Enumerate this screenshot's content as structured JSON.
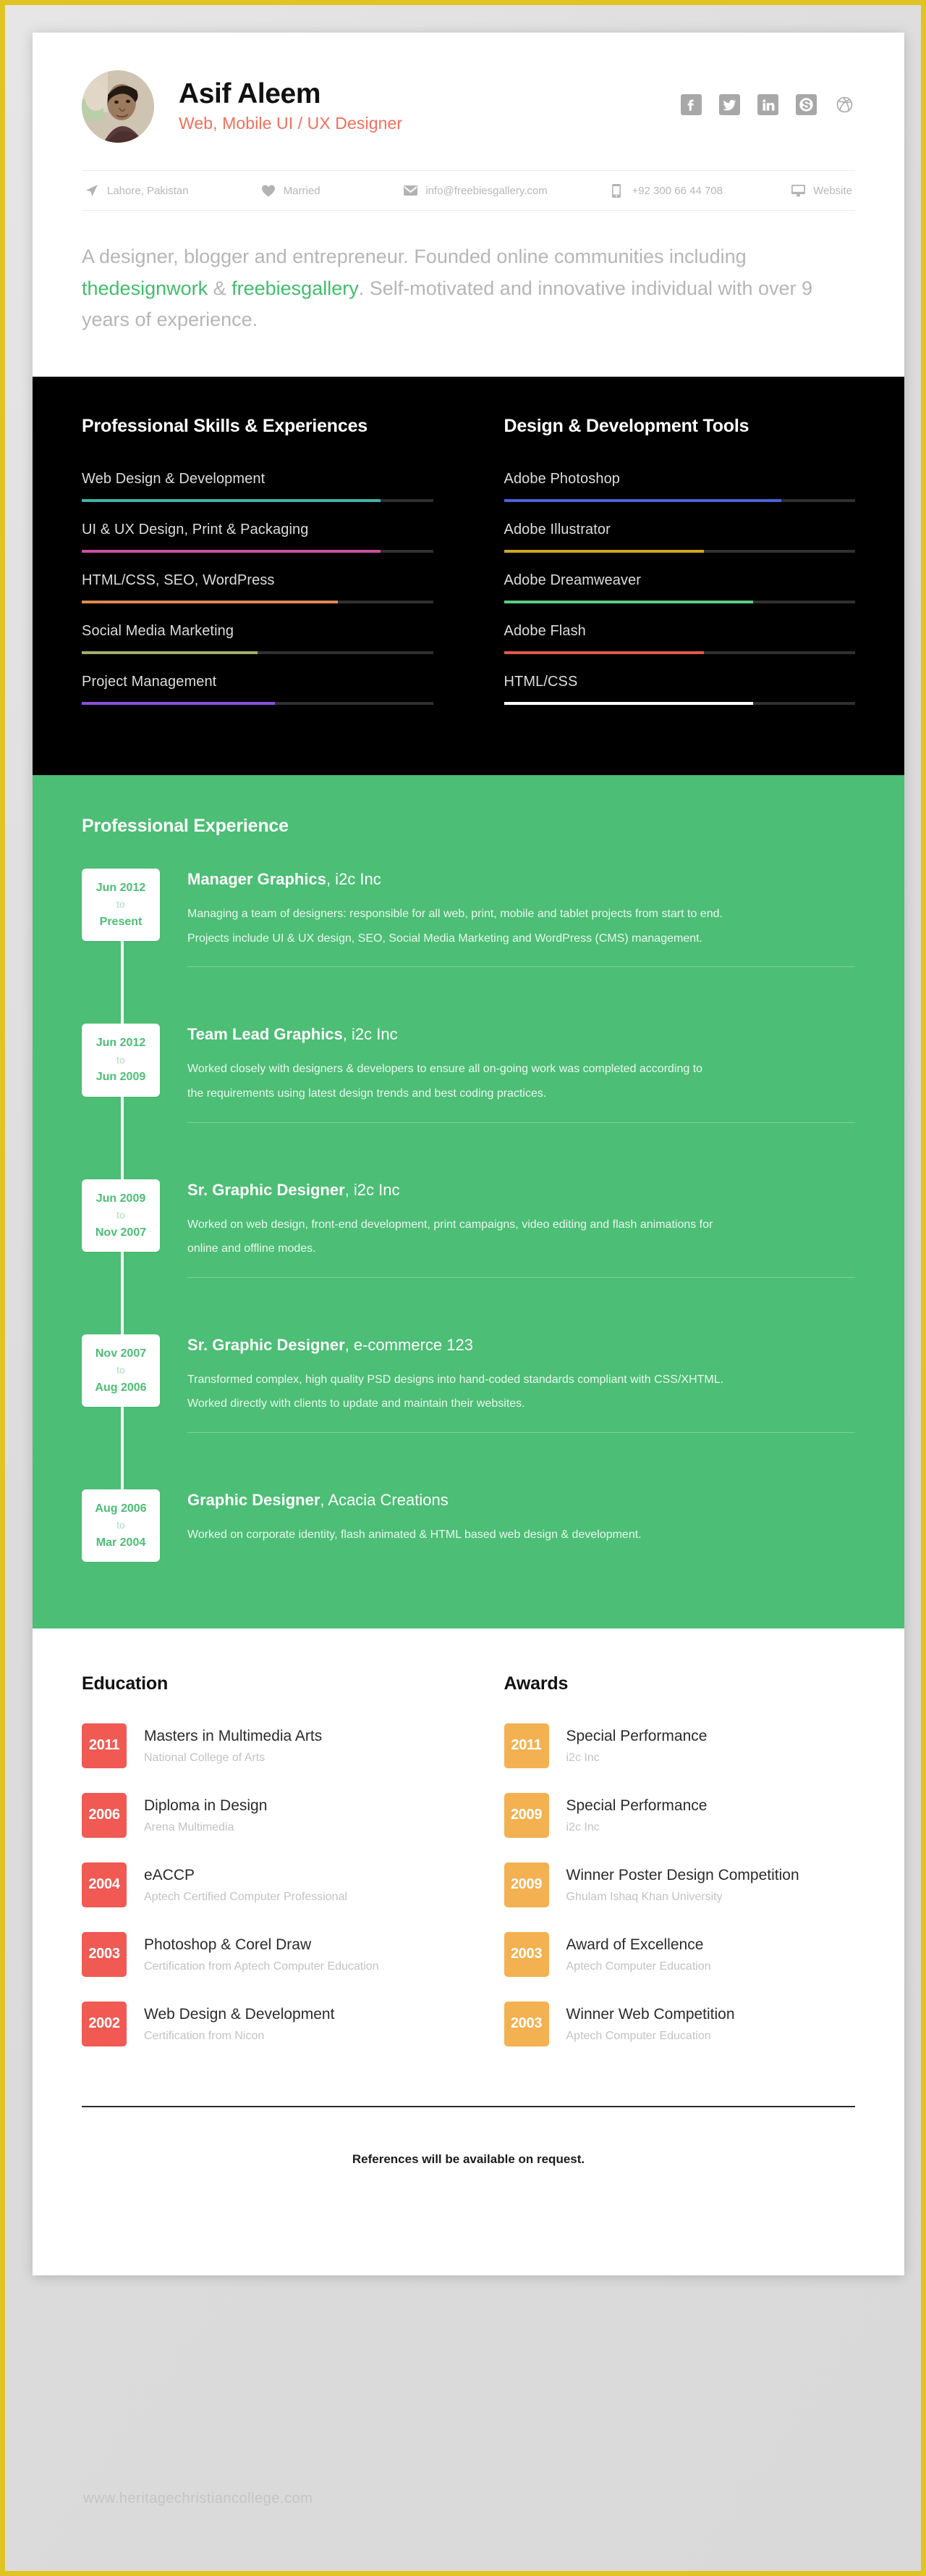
{
  "header": {
    "name": "Asif Aleem",
    "tagline": "Web, Mobile UI / UX Designer",
    "avatar_alt": "profile-photo",
    "socials": [
      {
        "name": "facebook",
        "label": "Facebook"
      },
      {
        "name": "twitter",
        "label": "Twitter"
      },
      {
        "name": "linkedin",
        "label": "LinkedIn"
      },
      {
        "name": "skype",
        "label": "Skype"
      },
      {
        "name": "dribbble",
        "label": "Dribbble"
      }
    ],
    "contact": {
      "location": "Lahore, Pakistan",
      "marital": "Married",
      "email": "info@freebiesgallery.com",
      "phone": "+92 300 66 44 708",
      "website": "Website"
    }
  },
  "intro": {
    "part1": "A designer, blogger and entrepreneur. Founded online communities including ",
    "link1": "thedesignwork",
    "amp": " & ",
    "link2": "freebiesgallery",
    "part2": ". Self-motivated and innovative individual with over 9 years of experience."
  },
  "skills": {
    "left_title": "Professional Skills & Experiences",
    "right_title": "Design & Development Tools",
    "left": [
      {
        "label": "Web Design & Development",
        "value": 85,
        "color": "#3fb5a8"
      },
      {
        "label": "UI & UX Design, Print & Packaging",
        "value": 85,
        "color": "#cc4f9e"
      },
      {
        "label": "HTML/CSS, SEO, WordPress",
        "value": 73,
        "color": "#e08a50"
      },
      {
        "label": "Social Media Marketing",
        "value": 50,
        "color": "#9fb06a"
      },
      {
        "label": "Project Management",
        "value": 55,
        "color": "#8c4ee0"
      }
    ],
    "right": [
      {
        "label": "Adobe Photoshop",
        "value": 79,
        "color": "#4a63d8"
      },
      {
        "label": "Adobe Illustrator",
        "value": 57,
        "color": "#cfa820"
      },
      {
        "label": "Adobe Dreamweaver",
        "value": 71,
        "color": "#5ecb82"
      },
      {
        "label": "Adobe Flash",
        "value": 57,
        "color": "#e2584a"
      },
      {
        "label": "HTML/CSS",
        "value": 71,
        "color": "#ffffff"
      }
    ]
  },
  "experience": {
    "title": "Professional Experience",
    "items": [
      {
        "from": "Jun 2012",
        "to_label": "to",
        "to": "Present",
        "role": "Manager Graphics",
        "company": ", i2c Inc",
        "lines": [
          "Managing a team of designers: responsible for all web, print, mobile and tablet projects from start to end.",
          "Projects include UI & UX design, SEO, Social Media Marketing and WordPress (CMS) management."
        ]
      },
      {
        "from": "Jun 2012",
        "to_label": "to",
        "to": "Jun 2009",
        "role": "Team Lead Graphics",
        "company": ", i2c Inc",
        "lines": [
          "Worked closely with designers & developers to ensure all on-going work was completed according to",
          "the requirements using latest design trends and best coding practices."
        ]
      },
      {
        "from": "Jun 2009",
        "to_label": "to",
        "to": "Nov 2007",
        "role": "Sr. Graphic Designer",
        "company": ", i2c Inc",
        "lines": [
          "Worked on web design, front-end development, print campaigns, video editing and flash animations for",
          "online and offline modes."
        ]
      },
      {
        "from": "Nov 2007",
        "to_label": "to",
        "to": "Aug 2006",
        "role": "Sr. Graphic Designer",
        "company": ", e-commerce 123",
        "lines": [
          "Transformed complex, high quality PSD designs into hand-coded standards compliant with CSS/XHTML.",
          "Worked directly with clients to update and maintain their websites."
        ]
      },
      {
        "from": "Aug 2006",
        "to_label": "to",
        "to": "Mar 2004",
        "role": "Graphic Designer",
        "company": ", Acacia Creations",
        "lines": [
          "Worked on corporate identity, flash animated & HTML based web design & development."
        ]
      }
    ]
  },
  "education": {
    "title": "Education",
    "items": [
      {
        "year": "2011",
        "title": "Masters in Multimedia Arts",
        "sub": "National College of Arts"
      },
      {
        "year": "2006",
        "title": "Diploma in Design",
        "sub": "Arena Multimedia"
      },
      {
        "year": "2004",
        "title": "eACCP",
        "sub": "Aptech Certified Computer Professional"
      },
      {
        "year": "2003",
        "title": "Photoshop & Corel Draw",
        "sub": "Certification from Aptech Computer Education"
      },
      {
        "year": "2002",
        "title": "Web Design & Development",
        "sub": "Certification from Nicon"
      }
    ]
  },
  "awards": {
    "title": "Awards",
    "items": [
      {
        "year": "2011",
        "title": "Special Performance",
        "sub": "i2c Inc"
      },
      {
        "year": "2009",
        "title": "Special Performance",
        "sub": "i2c Inc"
      },
      {
        "year": "2009",
        "title": "Winner Poster Design Competition",
        "sub": "Ghulam Ishaq Khan University"
      },
      {
        "year": "2003",
        "title": "Award of Excellence",
        "sub": "Aptech Computer Education"
      },
      {
        "year": "2003",
        "title": "Winner Web Competition",
        "sub": "Aptech Computer Education"
      }
    ]
  },
  "footer": {
    "note": "References will be available on request.",
    "watermark": "www.heritagechristiancollege.com"
  },
  "colors": {
    "accent_red": "#f0705d",
    "green": "#4cbe75",
    "edu_chip": "#f05a53",
    "award_chip": "#f3b151",
    "border": "#e0c426"
  }
}
